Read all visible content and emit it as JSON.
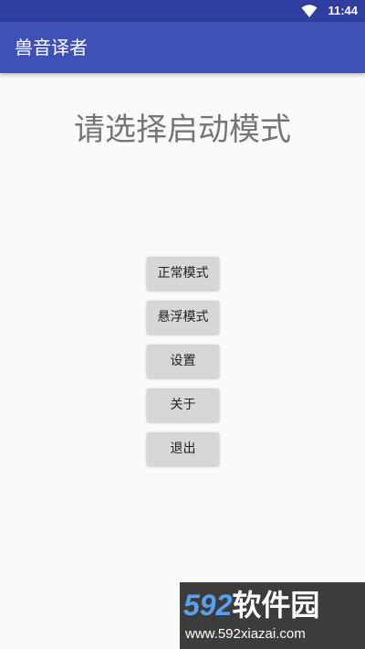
{
  "status_bar": {
    "time": "11:44",
    "wifi_icon": "wifi-icon",
    "color": "#303f9f"
  },
  "app_bar": {
    "title": "兽音译者",
    "color": "#3f51b5"
  },
  "main": {
    "prompt": "请选择启动模式",
    "buttons": [
      {
        "label": "正常模式"
      },
      {
        "label": "悬浮模式"
      },
      {
        "label": "设置"
      },
      {
        "label": "关于"
      },
      {
        "label": "退出"
      }
    ]
  },
  "watermark": {
    "logo_number": "592",
    "logo_text": "软件园",
    "url": "www.592xiazai.com"
  }
}
